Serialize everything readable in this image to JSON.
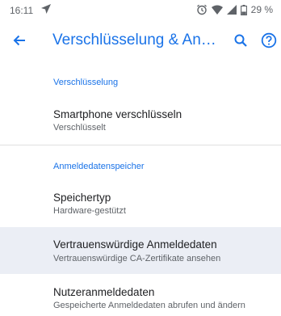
{
  "status_bar": {
    "time": "16:11",
    "battery": "29 %"
  },
  "app_bar": {
    "title": "Verschlüsselung & Anmeldedaten"
  },
  "sections": [
    {
      "header": "Verschlüsselung"
    },
    {
      "header": "Anmeldedatenspeicher"
    }
  ],
  "items": [
    {
      "title": "Smartphone verschlüsseln",
      "summary": "Verschlüsselt"
    },
    {
      "title": "Speichertyp",
      "summary": "Hardware-gestützt"
    },
    {
      "title": "Vertrauenswürdige Anmeldedaten",
      "summary": "Vertrauenswürdige CA-Zertifikate ansehen"
    },
    {
      "title": "Nutzeranmeldedaten",
      "summary": "Gespeicherte Anmeldedaten abrufen und ändern"
    }
  ],
  "colors": {
    "accent": "#1a73e8",
    "highlight": "#ebeef5",
    "text": "#202124",
    "secondary": "#5f6368"
  }
}
